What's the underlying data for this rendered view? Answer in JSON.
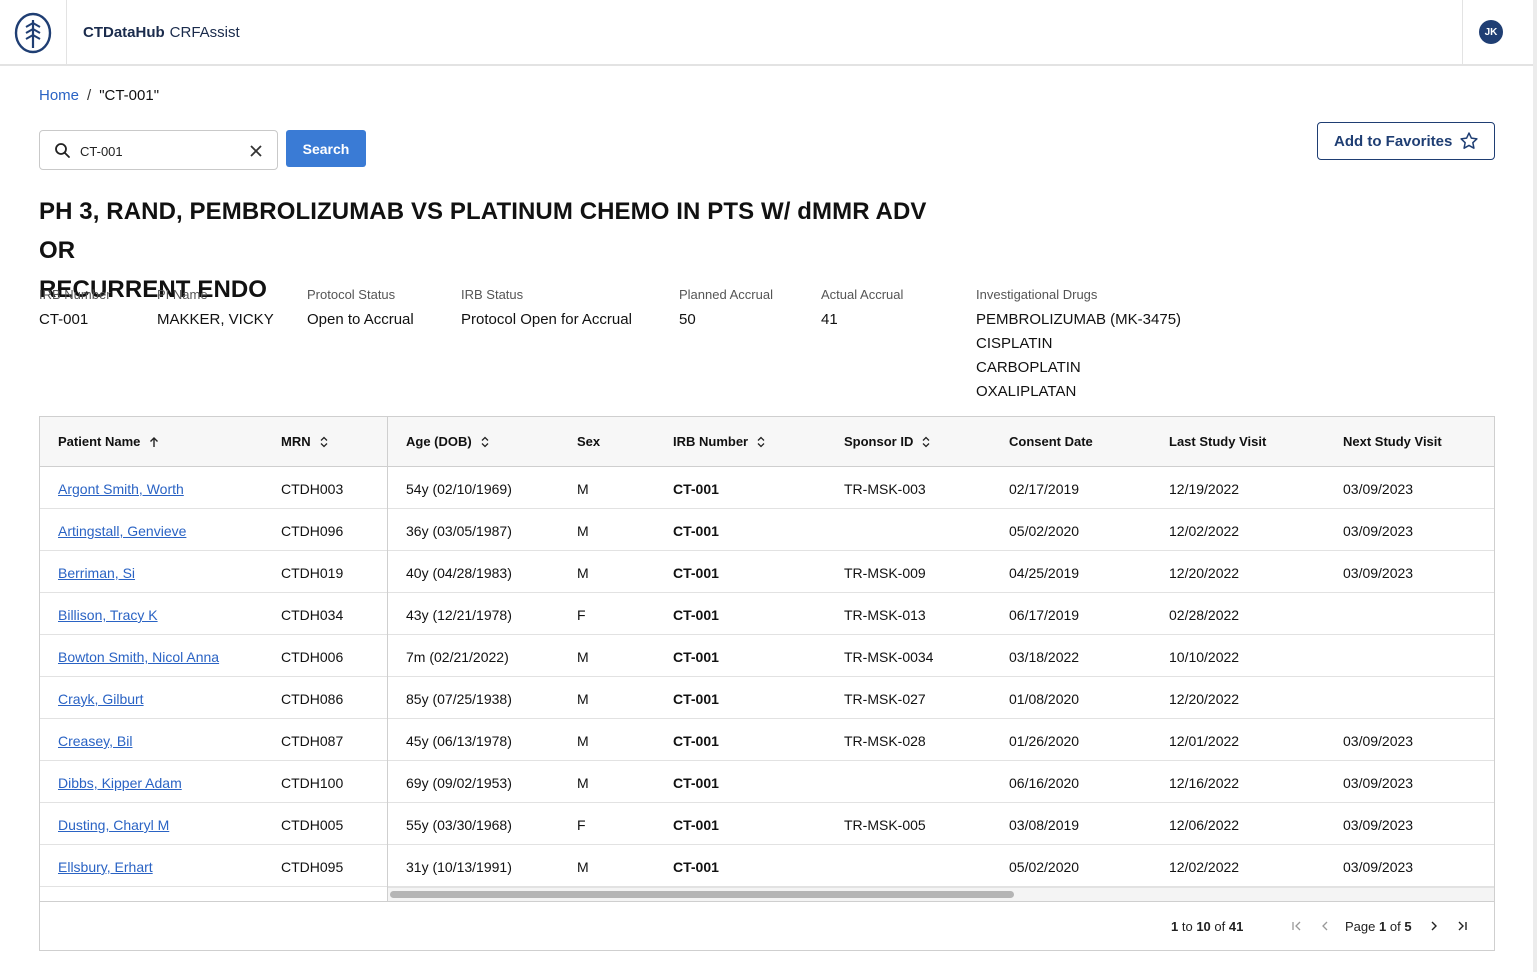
{
  "header": {
    "brand": "CTDataHub",
    "app": "CRFAssist",
    "avatar": "JK",
    "logo_icon": "tree-logo-icon"
  },
  "breadcrumb": {
    "home": "Home",
    "separator": "/",
    "current": "\"CT-001\""
  },
  "search": {
    "value": "CT-001",
    "button": "Search",
    "search_icon": "search-icon",
    "clear_icon": "close-icon"
  },
  "favorites": {
    "label": "Add to Favorites",
    "icon": "star-icon"
  },
  "study": {
    "title_line1": "PH 3, RAND, PEMBROLIZUMAB VS PLATINUM CHEMO IN PTS W/ dMMR ADV OR",
    "title_line2": "RECURRENT ENDO"
  },
  "meta": {
    "irb_number": {
      "label": "IRB Number",
      "value": "CT-001"
    },
    "pi_name": {
      "label": "PI Name",
      "value": "MAKKER, VICKY"
    },
    "protocol_status": {
      "label": "Protocol Status",
      "value": "Open to Accrual"
    },
    "irb_status": {
      "label": "IRB Status",
      "value": "Protocol Open for Accrual"
    },
    "planned_accrual": {
      "label": "Planned Accrual",
      "value": "50"
    },
    "actual_accrual": {
      "label": "Actual Accrual",
      "value": "41"
    },
    "drugs": {
      "label": "Investigational Drugs",
      "values": [
        "PEMBROLIZUMAB (MK-3475)",
        "CISPLATIN",
        "CARBOPLATIN",
        "OXALIPLATAN"
      ]
    }
  },
  "table": {
    "columns": [
      "Patient Name",
      "MRN",
      "Age (DOB)",
      "Sex",
      "IRB Number",
      "Sponsor ID",
      "Consent Date",
      "Last Study Visit",
      "Next Study Visit"
    ],
    "rows": [
      [
        "Argont Smith, Worth",
        "CTDH003",
        "54y (02/10/1969)",
        "M",
        "CT-001",
        "TR-MSK-003",
        "02/17/2019",
        "12/19/2022",
        "03/09/2023"
      ],
      [
        "Artingstall, Genvieve",
        "CTDH096",
        "36y (03/05/1987)",
        "M",
        "CT-001",
        "",
        "05/02/2020",
        "12/02/2022",
        "03/09/2023"
      ],
      [
        "Berriman, Si",
        "CTDH019",
        "40y (04/28/1983)",
        "M",
        "CT-001",
        "TR-MSK-009",
        "04/25/2019",
        "12/20/2022",
        "03/09/2023"
      ],
      [
        "Billison, Tracy K",
        "CTDH034",
        "43y (12/21/1978)",
        "F",
        "CT-001",
        "TR-MSK-013",
        "06/17/2019",
        "02/28/2022",
        ""
      ],
      [
        "Bowton Smith, Nicol Anna",
        "CTDH006",
        "7m (02/21/2022)",
        "M",
        "CT-001",
        "TR-MSK-0034",
        "03/18/2022",
        "10/10/2022",
        ""
      ],
      [
        "Crayk, Gilburt",
        "CTDH086",
        "85y (07/25/1938)",
        "M",
        "CT-001",
        "TR-MSK-027",
        "01/08/2020",
        "12/20/2022",
        ""
      ],
      [
        "Creasey, Bil",
        "CTDH087",
        "45y (06/13/1978)",
        "M",
        "CT-001",
        "TR-MSK-028",
        "01/26/2020",
        "12/01/2022",
        "03/09/2023"
      ],
      [
        "Dibbs, Kipper Adam",
        "CTDH100",
        "69y (09/02/1953)",
        "M",
        "CT-001",
        "",
        "06/16/2020",
        "12/16/2022",
        "03/09/2023"
      ],
      [
        "Dusting, Charyl M",
        "CTDH005",
        "55y (03/30/1968)",
        "F",
        "CT-001",
        "TR-MSK-005",
        "03/08/2019",
        "12/06/2022",
        "03/09/2023"
      ],
      [
        "Ellsbury, Erhart",
        "CTDH095",
        "31y (10/13/1991)",
        "M",
        "CT-001",
        "",
        "05/02/2020",
        "12/02/2022",
        "03/09/2023"
      ]
    ]
  },
  "pagination": {
    "from": "1",
    "to_word": "to",
    "to": "10",
    "of_word": "of",
    "total": "41",
    "page_word": "Page",
    "page": "1",
    "pages": "5"
  },
  "colors": {
    "accent": "#3a7bd5",
    "link": "#2a63c4",
    "navy": "#1f3e73"
  }
}
